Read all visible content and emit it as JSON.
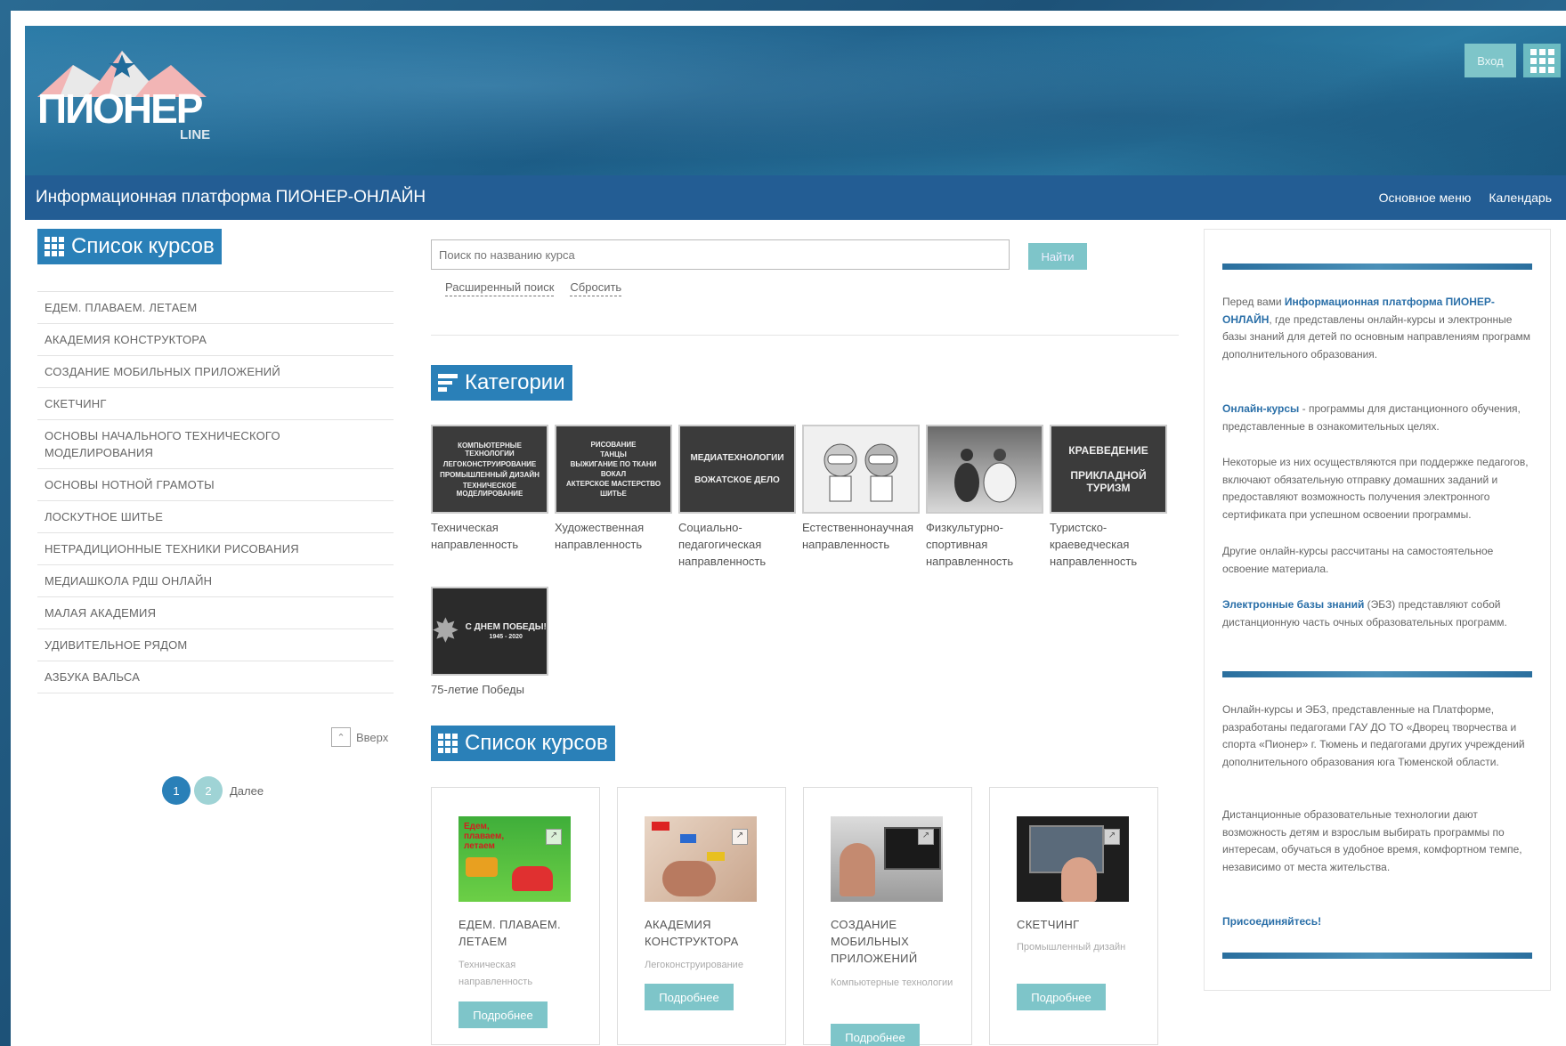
{
  "header": {
    "logo_text": "ПИОНЕР",
    "logo_subtext": "LINE",
    "login_label": "Вход"
  },
  "navbar": {
    "site_title": "Информационная платформа ПИОНЕР-ОНЛАЙН",
    "menu_items": [
      "Основное меню",
      "Календарь"
    ]
  },
  "sidebar": {
    "heading": "Список курсов",
    "courses": [
      "ЕДЕМ. ПЛАВАЕМ. ЛЕТАЕМ",
      "АКАДЕМИЯ КОНСТРУКТОРА",
      "СОЗДАНИЕ МОБИЛЬНЫХ ПРИЛОЖЕНИЙ",
      "СКЕТЧИНГ",
      "ОСНОВЫ НАЧАЛЬНОГО ТЕХНИЧЕСКОГО МОДЕЛИРОВАНИЯ",
      "ОСНОВЫ НОТНОЙ ГРАМОТЫ",
      "ЛОСКУТНОЕ ШИТЬЕ",
      "НЕТРАДИЦИОННЫЕ ТЕХНИКИ РИСОВАНИЯ",
      "МЕДИАШКОЛА РДШ ОНЛАЙН",
      "МАЛАЯ АКАДЕМИЯ",
      "УДИВИТЕЛЬНОЕ РЯДОМ",
      "АЗБУКА ВАЛЬСА"
    ],
    "up_label": "Вверх",
    "pagination": {
      "pages": [
        "1",
        "2"
      ],
      "next_label": "Далее",
      "current": "1"
    }
  },
  "search": {
    "placeholder": "Поиск по названию курса",
    "button_label": "Найти",
    "advanced_label": "Расширенный поиск",
    "reset_label": "Сбросить"
  },
  "categories": {
    "heading": "Категории",
    "items": [
      {
        "label": "Техническая направленность",
        "image_text": [
          "КОМПЬЮТЕРНЫЕ ТЕХНОЛОГИИ",
          "ЛЕГОКОНСТРУИРОВАНИЕ",
          "ПРОМЫШЛЕННЫЙ ДИЗАЙН",
          "ТЕХНИЧЕСКОЕ МОДЕЛИРОВАНИЕ"
        ]
      },
      {
        "label": "Художественная направленность",
        "image_text": [
          "РИСОВАНИЕ",
          "ТАНЦЫ",
          "ВЫЖИГАНИЕ ПО ТКАНИ",
          "ВОКАЛ",
          "АКТЕРСКОЕ МАСТЕРСТВО",
          "ШИТЬЕ"
        ]
      },
      {
        "label": "Социально-педагогическая направленность",
        "image_text": [
          "МЕДИАТЕХНОЛОГИИ",
          "ВОЖАТСКОЕ ДЕЛО"
        ]
      },
      {
        "label": "Естественнонаучная направленность",
        "image_text": []
      },
      {
        "label": "Физкультурно-спортивная направленность",
        "image_text": []
      },
      {
        "label": "Туристско-краеведческая направленность",
        "image_text": [
          "КРАЕВЕДЕНИЕ",
          "ПРИКЛАДНОЙ ТУРИЗМ"
        ]
      },
      {
        "label": "75-летие Победы",
        "image_text": [
          "С ДНЕМ ПОБЕДЫ!",
          "1945 - 2020"
        ]
      }
    ]
  },
  "course_cards": {
    "heading": "Список курсов",
    "button_label": "Подробнее",
    "items": [
      {
        "title": "ЕДЕМ. ПЛАВАЕМ. ЛЕТАЕМ",
        "subtitle": "Техническая направленность",
        "image_text": "Едем, плаваем, летаем"
      },
      {
        "title": "АКАДЕМИЯ КОНСТРУКТОРА",
        "subtitle": "Легоконструирование",
        "image_text": ""
      },
      {
        "title": "СОЗДАНИЕ МОБИЛЬНЫХ ПРИЛОЖЕНИЙ",
        "subtitle": "Компьютерные технологии",
        "image_text": ""
      },
      {
        "title": "СКЕТЧИНГ",
        "subtitle": "Промышленный дизайн",
        "image_text": ""
      }
    ]
  },
  "info": {
    "p1_prefix": "Перед вами ",
    "p1_bold": "Информационная платформа ПИОНЕР-ОНЛАЙН",
    "p1_suffix": ", где представлены онлайн-курсы и электронные базы знаний для детей по основным направлениям программ дополнительного образования.",
    "p2_bold": "Онлайн-курсы",
    "p2_suffix": " - программы для дистанционного обучения, представленные в ознакомительных целях.",
    "p3": "Некоторые из них осуществляются при поддержке педагогов, включают обязательную отправку домашних заданий и предоставляют возможность получения электронного сертификата при успешном освоении программы.",
    "p4": "Другие онлайн-курсы рассчитаны на самостоятельное освоение материала.",
    "p5_bold": "Электронные базы знаний",
    "p5_suffix": " (ЭБЗ) представляют собой дистанционную часть очных образовательных программ.",
    "p6": "Онлайн-курсы и ЭБЗ, представленные на Платформе, разработаны педагогами ГАУ ДО ТО «Дворец творчества и спорта «Пионер» г. Тюмень и педагогами других учреждений дополнительного образования юга Тюменской области.",
    "p7": "Дистанционные образовательные технологии дают возможность детям и взрослым выбирать программы по интересам, обучаться в удобное время, комфортном темпе, независимо от места жительства.",
    "p8_bold": "Присоединяйтесь!"
  },
  "colors": {
    "brand_blue": "#235d94",
    "heading_blue": "#2a80b8",
    "button_teal": "#7ec5c9",
    "link_blue": "#2a6fa8"
  }
}
